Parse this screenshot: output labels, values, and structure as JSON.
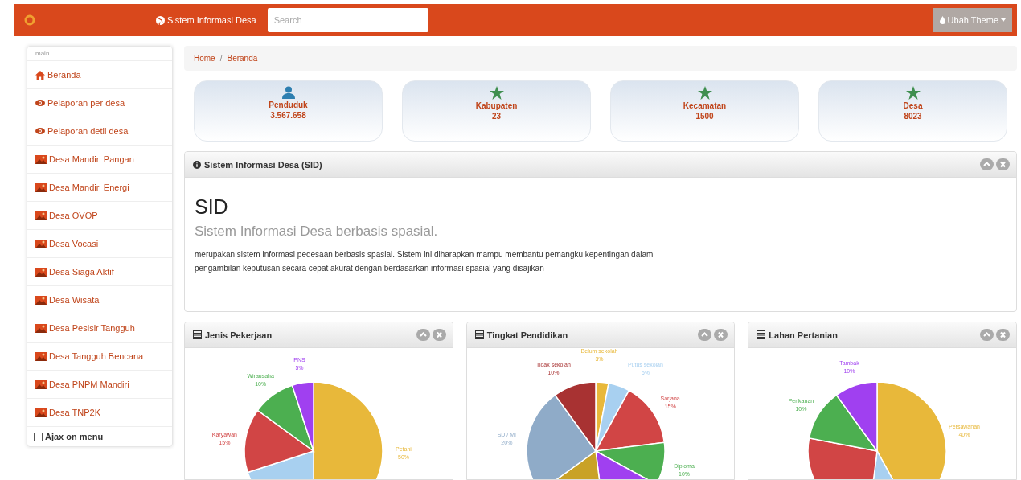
{
  "navbar": {
    "brand": "Sistem Informasi Desa",
    "search": {
      "placeholder": "Search"
    },
    "theme_button": "Ubah Theme"
  },
  "sidebar": {
    "header": "main",
    "items": [
      {
        "label": "Beranda",
        "kind": "home"
      },
      {
        "label": "Pelaporan per desa",
        "kind": "eye"
      },
      {
        "label": "Pelaporan detil desa",
        "kind": "eye"
      },
      {
        "label": "Desa Mandiri Pangan",
        "kind": "image"
      },
      {
        "label": "Desa Mandiri Energi",
        "kind": "image"
      },
      {
        "label": "Desa OVOP",
        "kind": "image"
      },
      {
        "label": "Desa Vocasi",
        "kind": "image"
      },
      {
        "label": "Desa Siaga Aktif",
        "kind": "image"
      },
      {
        "label": "Desa Wisata",
        "kind": "image"
      },
      {
        "label": "Desa Pesisir Tangguh",
        "kind": "image"
      },
      {
        "label": "Desa Tangguh Bencana",
        "kind": "image"
      },
      {
        "label": "Desa PNPM Mandiri",
        "kind": "image"
      },
      {
        "label": "Desa TNP2K",
        "kind": "image"
      }
    ],
    "ajax_toggle": {
      "label": "Ajax on menu",
      "checked": false
    }
  },
  "breadcrumb": {
    "items": [
      "Home",
      "Beranda"
    ],
    "separator": "/"
  },
  "stats": [
    {
      "kind": "person",
      "label": "Penduduk",
      "value": "3.567.658"
    },
    {
      "kind": "star",
      "label": "Kabupaten",
      "value": "23"
    },
    {
      "kind": "star",
      "label": "Kecamatan",
      "value": "1500"
    },
    {
      "kind": "star",
      "label": "Desa",
      "value": "8023"
    }
  ],
  "info_panel": {
    "title": "Sistem Informasi Desa (SID)",
    "heading": "SID",
    "subheading": "Sistem Informasi Desa berbasis spasial.",
    "text": "merupakan sistem informasi pedesaan berbasis spasial. Sistem ini diharapkan mampu membantu pemangku kepentingan dalam pengambilan keputusan secara cepat akurat dengan berdasarkan informasi spasial yang disajikan"
  },
  "chart_panels": [
    {
      "title": "Jenis Pekerjaan",
      "slices": [
        {
          "label": "Petani",
          "percent": "50%",
          "color": "#e8b83a"
        },
        {
          "color": "#a8d0f0"
        },
        {
          "label": "Karyawan",
          "percent": "15%",
          "color": "#d14545"
        },
        {
          "label": "Wirausaha",
          "percent": "10%",
          "color": "#4caf50"
        },
        {
          "label": "PNS",
          "percent": "5%",
          "color": "#a040f0"
        }
      ]
    },
    {
      "title": "Tingkat Pendidikan",
      "slices": [
        {
          "label": "Belum sekolah",
          "percent": "3%",
          "color": "#e8b83a"
        },
        {
          "label": "Putus sekolah",
          "percent": "5%",
          "color": "#a8d0f0"
        },
        {
          "label": "Sarjana",
          "percent": "15%",
          "color": "#d14545"
        },
        {
          "label": "Diploma",
          "percent": "10%",
          "color": "#4caf50"
        },
        {
          "color": "#a040f0"
        },
        {
          "color": "#c9a227"
        },
        {
          "label": "SD / MI",
          "percent": "20%",
          "color": "#8fabc8"
        },
        {
          "label": "Tidak sekolah",
          "percent": "10%",
          "color": "#a83232"
        }
      ]
    },
    {
      "title": "Lahan Pertanian",
      "slices": [
        {
          "label": "Persawahan",
          "percent": "40%",
          "color": "#e8b83a"
        },
        {
          "color": "#a8d0f0"
        },
        {
          "color": "#d14545"
        },
        {
          "label": "Perikanan",
          "percent": "10%",
          "color": "#4caf50"
        },
        {
          "label": "Tambak",
          "percent": "10%",
          "color": "#a040f0"
        }
      ]
    }
  ]
}
